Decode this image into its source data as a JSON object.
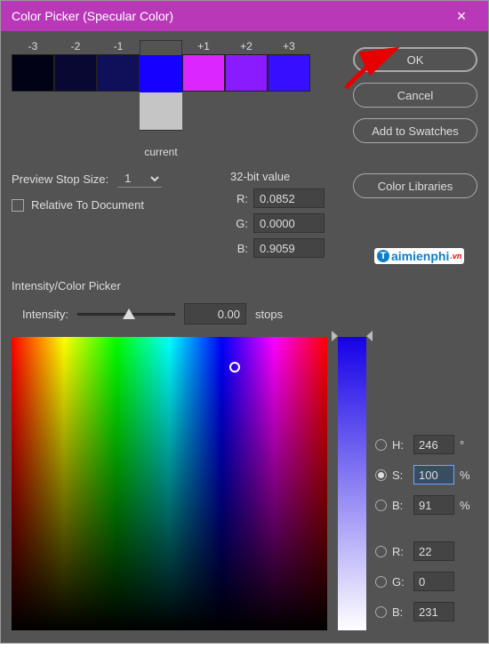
{
  "window": {
    "title": "Color Picker (Specular Color)"
  },
  "swatch_labels": [
    "-3",
    "-2",
    "-1",
    "",
    "+1",
    "+2",
    "+3"
  ],
  "swatch_colors": [
    "#020216",
    "#080832",
    "#100f5a",
    "#1600ff",
    "#db26ff",
    "#8a1aff",
    "#370eff"
  ],
  "current_label": "current",
  "current_color": "#c5c5c5",
  "preview": {
    "label": "Preview Stop Size:",
    "value": "1"
  },
  "relative": {
    "label": "Relative To Document"
  },
  "bit32": {
    "title": "32-bit value",
    "rows": [
      {
        "lab": "R:",
        "val": "0.0852"
      },
      {
        "lab": "G:",
        "val": "0.0000"
      },
      {
        "lab": "B:",
        "val": "0.9059"
      }
    ]
  },
  "buttons": {
    "ok": "OK",
    "cancel": "Cancel",
    "swatches": "Add to Swatches",
    "libraries": "Color Libraries"
  },
  "section": "Intensity/Color Picker",
  "intensity": {
    "label": "Intensity:",
    "value": "0.00",
    "unit": "stops"
  },
  "hsb": {
    "h": {
      "lab": "H:",
      "val": "246",
      "unit": "°"
    },
    "s": {
      "lab": "S:",
      "val": "100",
      "unit": "%"
    },
    "b": {
      "lab": "B:",
      "val": "91",
      "unit": "%"
    }
  },
  "rgb": {
    "r": {
      "lab": "R:",
      "val": "22"
    },
    "g": {
      "lab": "G:",
      "val": "0"
    },
    "b": {
      "lab": "B:",
      "val": "231"
    }
  },
  "watermark": {
    "text": "aimienphi",
    "suffix": ".vn"
  }
}
